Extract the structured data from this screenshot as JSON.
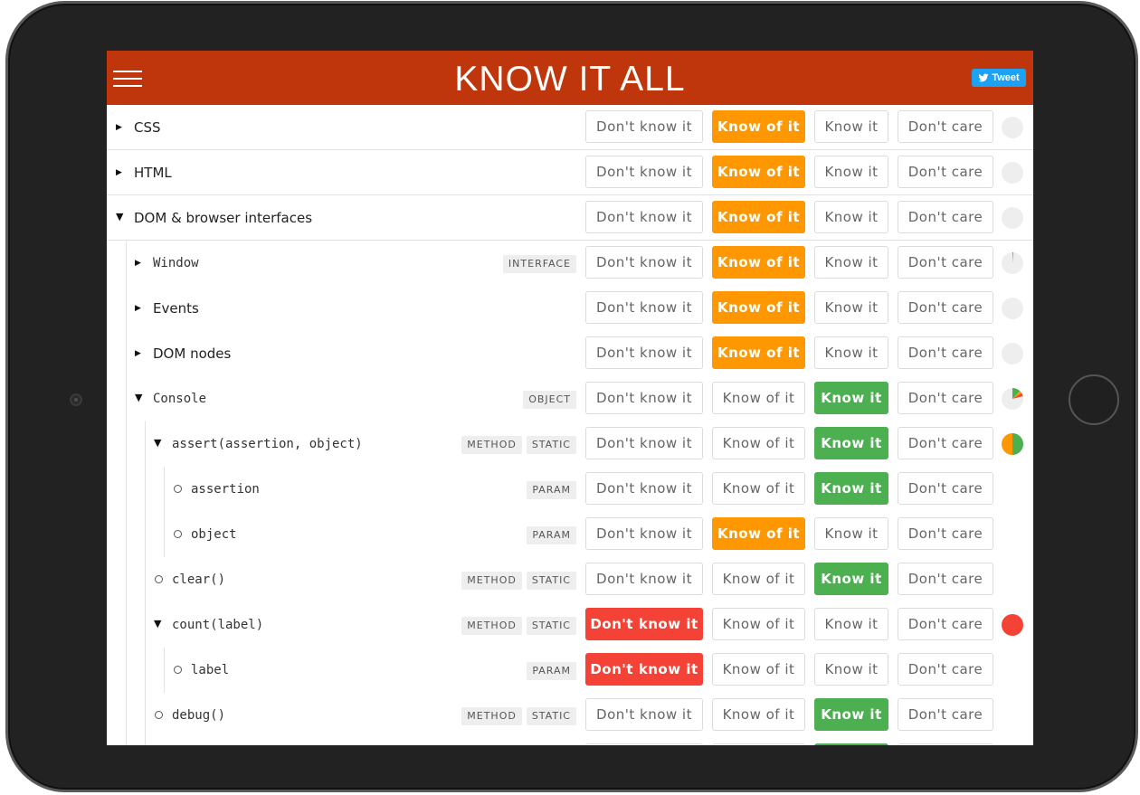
{
  "app": {
    "title": "KNOW IT ALL",
    "tweet_label": "Tweet"
  },
  "colors": {
    "header": "#bf360c",
    "dont_know": "#f44336",
    "know_of": "#ff9800",
    "know": "#4caf50",
    "progress_empty": "#eeeeee"
  },
  "options": [
    "Don't know it",
    "Know of it",
    "Know it",
    "Don't care"
  ],
  "rows": [
    {
      "label": "CSS",
      "level": 0,
      "expander": "collapsed",
      "mono": false,
      "tags": [],
      "selected": 1,
      "progress": {
        "know_it": 0,
        "know_of": 0,
        "dont_know": 0
      }
    },
    {
      "label": "HTML",
      "level": 0,
      "expander": "collapsed",
      "mono": false,
      "tags": [],
      "selected": 1,
      "progress": {
        "know_it": 0,
        "know_of": 0,
        "dont_know": 0
      }
    },
    {
      "label": "DOM & browser interfaces",
      "level": 0,
      "expander": "expanded",
      "mono": false,
      "tags": [],
      "selected": 1,
      "progress": {
        "know_it": 0,
        "know_of": 0,
        "dont_know": 0
      }
    },
    {
      "label": "Window",
      "level": 1,
      "expander": "collapsed",
      "mono": true,
      "tags": [
        "INTERFACE"
      ],
      "selected": 1,
      "progress": {
        "know_it": 0,
        "know_of": 0,
        "dont_know": 0.01
      }
    },
    {
      "label": "Events",
      "level": 1,
      "expander": "collapsed",
      "mono": false,
      "tags": [],
      "selected": 1,
      "progress": {
        "know_it": 0,
        "know_of": 0,
        "dont_know": 0
      }
    },
    {
      "label": "DOM nodes",
      "level": 1,
      "expander": "collapsed",
      "mono": false,
      "tags": [],
      "selected": 1,
      "progress": {
        "know_it": 0,
        "know_of": 0,
        "dont_know": 0
      }
    },
    {
      "label": "Console",
      "level": 1,
      "expander": "expanded",
      "mono": true,
      "tags": [
        "OBJECT"
      ],
      "selected": 2,
      "progress": {
        "know_it": 0.12,
        "know_of": 0.04,
        "dont_know": 0.05
      }
    },
    {
      "label": "assert(assertion, object)",
      "level": 2,
      "expander": "expanded",
      "mono": true,
      "tags": [
        "METHOD",
        "STATIC"
      ],
      "selected": 2,
      "progress": {
        "know_it": 0.5,
        "know_of": 0.5,
        "dont_know": 0
      }
    },
    {
      "label": "assertion",
      "level": 3,
      "expander": "leaf",
      "mono": true,
      "tags": [
        "PARAM"
      ],
      "selected": 2,
      "progress": null
    },
    {
      "label": "object",
      "level": 3,
      "expander": "leaf",
      "mono": true,
      "tags": [
        "PARAM"
      ],
      "selected": 1,
      "progress": null
    },
    {
      "label": "clear()",
      "level": 2,
      "expander": "leaf",
      "mono": true,
      "tags": [
        "METHOD",
        "STATIC"
      ],
      "selected": 2,
      "progress": null
    },
    {
      "label": "count(label)",
      "level": 2,
      "expander": "expanded",
      "mono": true,
      "tags": [
        "METHOD",
        "STATIC"
      ],
      "selected": 0,
      "progress": {
        "know_it": 0,
        "know_of": 0,
        "dont_know": 1
      }
    },
    {
      "label": "label",
      "level": 3,
      "expander": "leaf",
      "mono": true,
      "tags": [
        "PARAM"
      ],
      "selected": 0,
      "progress": null
    },
    {
      "label": "debug()",
      "level": 2,
      "expander": "leaf",
      "mono": true,
      "tags": [
        "METHOD",
        "STATIC"
      ],
      "selected": 2,
      "progress": null
    },
    {
      "label": "",
      "level": 2,
      "expander": "none",
      "mono": true,
      "tags": [],
      "selected": 2,
      "progress": null
    }
  ]
}
